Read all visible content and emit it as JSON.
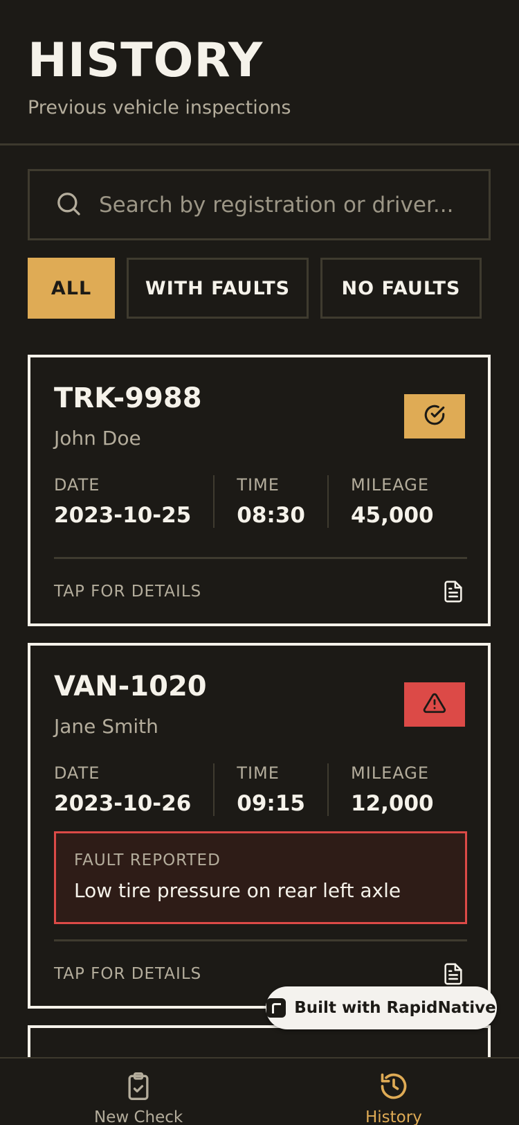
{
  "header": {
    "title": "HISTORY",
    "subtitle": "Previous vehicle inspections"
  },
  "search": {
    "placeholder": "Search by registration or driver...",
    "value": ""
  },
  "filters": [
    {
      "label": "ALL",
      "active": true
    },
    {
      "label": "WITH FAULTS",
      "active": false
    },
    {
      "label": "NO FAULTS",
      "active": false
    }
  ],
  "inspections": [
    {
      "registration": "TRK-9988",
      "driver": "John Doe",
      "status_icon": "check-circle-icon",
      "date_label": "DATE",
      "date": "2023-10-25",
      "time_label": "TIME",
      "time": "08:30",
      "mileage_label": "MILEAGE",
      "mileage": "45,000",
      "details_label": "TAP FOR DETAILS"
    },
    {
      "registration": "VAN-1020",
      "driver": "Jane Smith",
      "status_icon": "warning-triangle-icon",
      "date_label": "DATE",
      "date": "2023-10-26",
      "time_label": "TIME",
      "time": "09:15",
      "mileage_label": "MILEAGE",
      "mileage": "12,000",
      "fault_label": "FAULT REPORTED",
      "fault_text": "Low tire pressure on rear left axle",
      "details_label": "TAP FOR DETAILS"
    }
  ],
  "badge": {
    "label": "Built with RapidNative"
  },
  "tabbar": {
    "new_check_label": "New Check",
    "history_label": "History"
  },
  "colors": {
    "background": "#1c1a16",
    "accent": "#dfab55",
    "fault": "#dc4a47",
    "muted_text": "#b4ad9c"
  }
}
